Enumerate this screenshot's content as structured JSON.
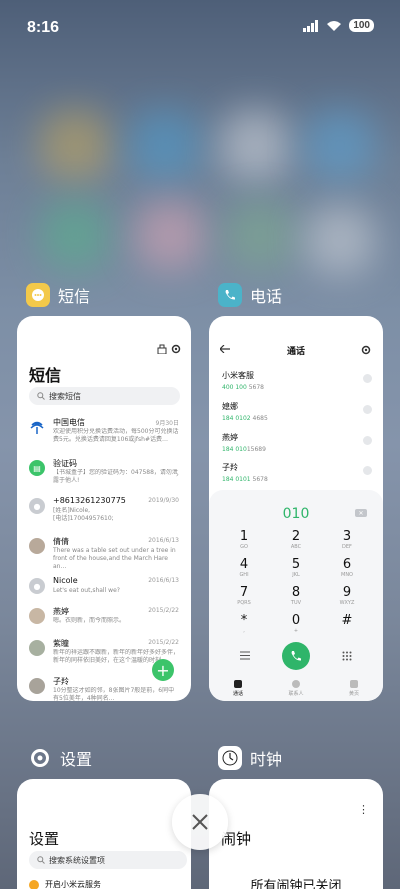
{
  "status_bar": {
    "time": "8:16",
    "battery": "100"
  },
  "apps": {
    "sms": {
      "label": "短信",
      "title": "短信",
      "search_placeholder": "搜索短信",
      "messages": [
        {
          "name": "中国电信",
          "date": "9月30日",
          "preview": "欢迎使用积分兑换话费活动，每500分可兑换话费5元。兑换话费请回复106或jfsh#话费…",
          "avatar": "telecom"
        },
        {
          "name": "验证码",
          "date": "",
          "preview": "【书城盒子】您的验证码为：047588，请勿泄露于他人!",
          "avatar": "sms"
        },
        {
          "name": "+8613261230775",
          "date": "2019/9/30",
          "preview": "[姓名]Nicole,\n[电话]17004957610;",
          "avatar": "person"
        },
        {
          "name": "倩倩",
          "date": "2016/6/13",
          "preview": "There was a table set out under a tree in front of the house,and the March Hare an…",
          "avatar": "photo"
        },
        {
          "name": "Nicole",
          "date": "2016/6/13",
          "preview": "Let's eat out,shall we?",
          "avatar": "person"
        },
        {
          "name": "燕婷",
          "date": "2015/2/22",
          "preview": "嗯。衣则新，而今而照示。",
          "avatar": "photo"
        },
        {
          "name": "紫瞳",
          "date": "2015/2/22",
          "preview": "新年的祥运跟不跟新，新年的新年好多好多伴，新年的同样依旧美好，在这个温暖的时刻…",
          "avatar": "photo"
        },
        {
          "name": "子羚",
          "date": "",
          "preview": "10分整这才如的邻，8张图片7般是前，6同中有5位美年，4种同名…",
          "avatar": "photo"
        }
      ]
    },
    "phone": {
      "label": "电话",
      "title": "通话",
      "contacts": [
        {
          "name": "小米客服",
          "num_hl": "400 100",
          "num_rest": " 5678"
        },
        {
          "name": "媳娜",
          "num_hl": "184 0102",
          "num_rest": " 4685"
        },
        {
          "name": "燕婷",
          "num_hl": "184 010",
          "num_rest": "15689"
        },
        {
          "name": "子羚",
          "num_hl": "184 0101",
          "num_rest": " 5678"
        }
      ],
      "dial_display": "010",
      "keys": [
        {
          "d": "1",
          "l": "GO"
        },
        {
          "d": "2",
          "l": "ABC"
        },
        {
          "d": "3",
          "l": "DEF"
        },
        {
          "d": "4",
          "l": "GHI"
        },
        {
          "d": "5",
          "l": "JKL"
        },
        {
          "d": "6",
          "l": "MNO"
        },
        {
          "d": "7",
          "l": "PQRS"
        },
        {
          "d": "8",
          "l": "TUV"
        },
        {
          "d": "9",
          "l": "WXYZ"
        },
        {
          "d": "*",
          "l": ","
        },
        {
          "d": "0",
          "l": "+"
        },
        {
          "d": "#",
          "l": ""
        }
      ],
      "tabs": [
        "通话",
        "联系人",
        "黄页"
      ]
    },
    "settings": {
      "label": "设置",
      "title": "设置",
      "search_placeholder": "搜索系统设置项",
      "row_text": "开启小米云服务"
    },
    "clock": {
      "label": "时钟",
      "title": "闹钟",
      "message": "所有闹钟已关闭"
    }
  },
  "colors": {
    "accent_green": "#2fb56a",
    "sms_icon": "#f3c94a",
    "phone_icon": "#4bb3c9"
  }
}
